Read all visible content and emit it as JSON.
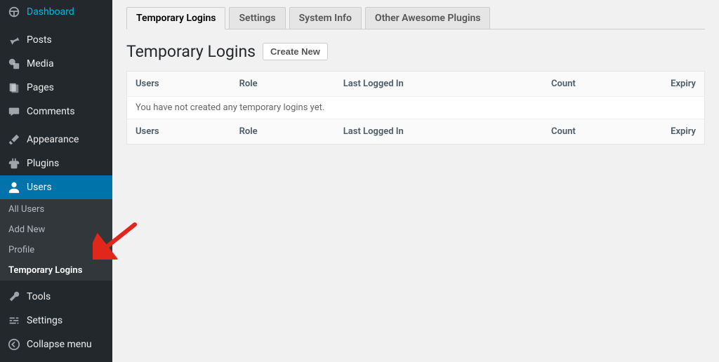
{
  "sidebar": {
    "items": [
      {
        "label": "Dashboard"
      },
      {
        "label": "Posts"
      },
      {
        "label": "Media"
      },
      {
        "label": "Pages"
      },
      {
        "label": "Comments"
      },
      {
        "label": "Appearance"
      },
      {
        "label": "Plugins"
      },
      {
        "label": "Users"
      },
      {
        "label": "Tools"
      },
      {
        "label": "Settings"
      },
      {
        "label": "Collapse menu"
      }
    ],
    "submenu": [
      {
        "label": "All Users"
      },
      {
        "label": "Add New"
      },
      {
        "label": "Profile"
      },
      {
        "label": "Temporary Logins"
      }
    ]
  },
  "tabs": [
    {
      "label": "Temporary Logins"
    },
    {
      "label": "Settings"
    },
    {
      "label": "System Info"
    },
    {
      "label": "Other Awesome Plugins"
    }
  ],
  "page": {
    "title": "Temporary Logins",
    "create_button": "Create New",
    "empty_message": "You have not created any temporary logins yet."
  },
  "columns": {
    "users": "Users",
    "role": "Role",
    "last_login": "Last Logged In",
    "count": "Count",
    "expiry": "Expiry"
  }
}
